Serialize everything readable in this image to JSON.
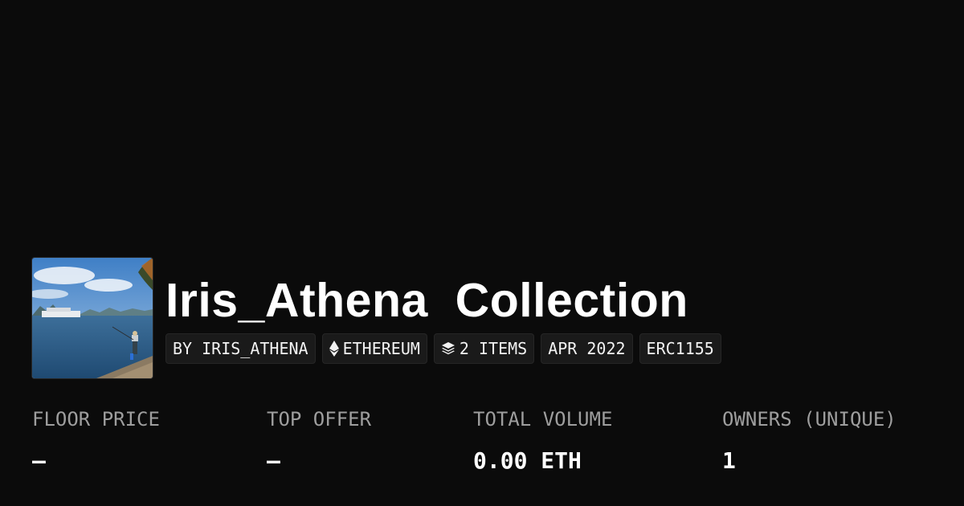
{
  "collection": {
    "title": "Iris_Athena  Collection",
    "image_alt": "lake-fisherman-photo"
  },
  "badges": [
    {
      "label": "BY IRIS_ATHENA",
      "icon": ""
    },
    {
      "label": "ETHEREUM",
      "icon": "ethereum-icon"
    },
    {
      "label": "2 ITEMS",
      "icon": "layers-icon"
    },
    {
      "label": "APR 2022",
      "icon": ""
    },
    {
      "label": "ERC1155",
      "icon": ""
    }
  ],
  "stats": [
    {
      "label": "FLOOR PRICE",
      "value": "—"
    },
    {
      "label": "TOP OFFER",
      "value": "—"
    },
    {
      "label": "TOTAL VOLUME",
      "value": "0.00 ETH"
    },
    {
      "label": "OWNERS (UNIQUE)",
      "value": "1"
    }
  ],
  "colors": {
    "background": "#0b0b0b",
    "badge_bg": "#1a1a1a",
    "label": "#9e9e9e",
    "text": "#ffffff"
  }
}
